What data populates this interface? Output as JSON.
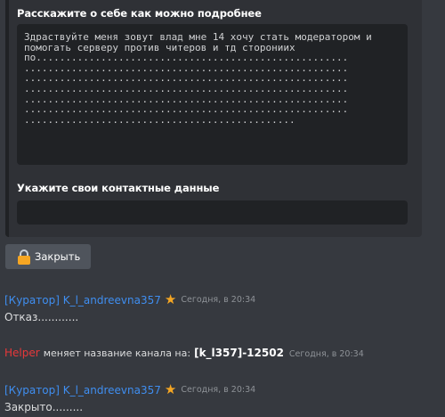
{
  "embed": {
    "field1": {
      "title": "Расскажите о себе как можно подробнее",
      "text": "Здраствуйте меня зовут влад мне 14 хочу стать модератором и\nпомогать серверу против читеров и тд сторониих\nпо.....................................................\n.......................................................\n.......................................................\n.......................................................\n.......................................................\n.......................................................\n.............................................."
    },
    "field2": {
      "title": "Укажите свои контактные данные",
      "value": ""
    }
  },
  "close_button": {
    "label": "Закрыть",
    "icon": "lock-icon"
  },
  "messages": [
    {
      "author": "[Куратор] K_l_andreevna357",
      "badge_icon": "star-icon",
      "time": "Сегодня, в 20:34",
      "text": "Отказ............"
    },
    {
      "author": "[Куратор] K_l_andreevna357",
      "badge_icon": "star-icon",
      "time": "Сегодня, в 20:34",
      "text": "Закрыто........."
    }
  ],
  "system_message": {
    "user": "Helper",
    "text": "меняет название канала на:",
    "channel": "[k_l357]-12502",
    "time": "Сегодня, в 20:34"
  },
  "colors": {
    "background": "#36393f",
    "embed_background": "#2f3136",
    "code_background": "#202225",
    "author": "#3f8ef0",
    "helper": "#e8383a",
    "star": "#f5a623",
    "button": "#4f545c"
  }
}
